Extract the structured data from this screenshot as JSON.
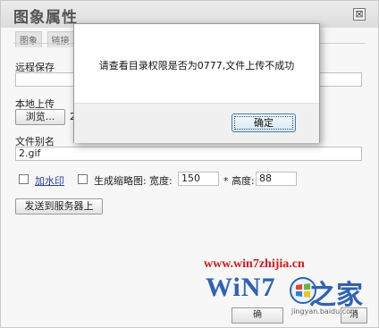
{
  "dialog": {
    "title": "图象属性",
    "close_symbol": "⊠",
    "tabs": [
      "图象",
      "链接"
    ],
    "remote_save_label": "远程保存",
    "local_upload_label": "本地上传",
    "browse_button": "浏览...",
    "file_value_prefix": "2",
    "alias_label": "文件别名",
    "alias_value": "2.gif",
    "watermark_label": "加水印",
    "thumbnail_label": "生成缩略图:",
    "width_label": "宽度:",
    "width_value": "150",
    "height_label": "* 高度:",
    "height_value": "88",
    "send_button": "发送到服务器上",
    "footer_ok": "确",
    "footer_cancel": "消"
  },
  "alert": {
    "message": "请查看目录权限是否为0777,文件上传不成功",
    "ok_button": "确定"
  },
  "watermark": {
    "url": "www.win7zhijia.cn",
    "logo_text": "WiN7",
    "logo_cn": "之家",
    "source": "jingyan.baidu.com"
  },
  "colors": {
    "logo_blue": "#2f62b5",
    "url_red": "#d51a1a",
    "link_blue": "#2a3ea8"
  }
}
